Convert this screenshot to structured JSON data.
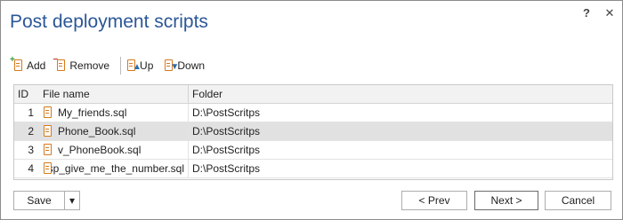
{
  "window": {
    "title": "Post deployment scripts",
    "help": "?",
    "close": "✕"
  },
  "toolbar": {
    "add": "Add",
    "remove": "Remove",
    "up": "Up",
    "down": "Down"
  },
  "table": {
    "columns": [
      "ID",
      "File name",
      "Folder"
    ],
    "rows": [
      {
        "id": "1",
        "file": "My_friends.sql",
        "folder": "D:\\PostScritps"
      },
      {
        "id": "2",
        "file": "Phone_Book.sql",
        "folder": "D:\\PostScritps"
      },
      {
        "id": "3",
        "file": "v_PhoneBook.sql",
        "folder": "D:\\PostScritps"
      },
      {
        "id": "4",
        "file": "sp_give_me_the_number.sql",
        "folder": "D:\\PostScritps"
      }
    ],
    "selected_row": 2
  },
  "footer": {
    "save": "Save",
    "dropdown": "▾",
    "prev": "< Prev",
    "next": "Next >",
    "cancel": "Cancel"
  },
  "colors": {
    "title": "#2b5797",
    "icon": "#d77a1c",
    "selected_row": "#e1e1e1"
  }
}
